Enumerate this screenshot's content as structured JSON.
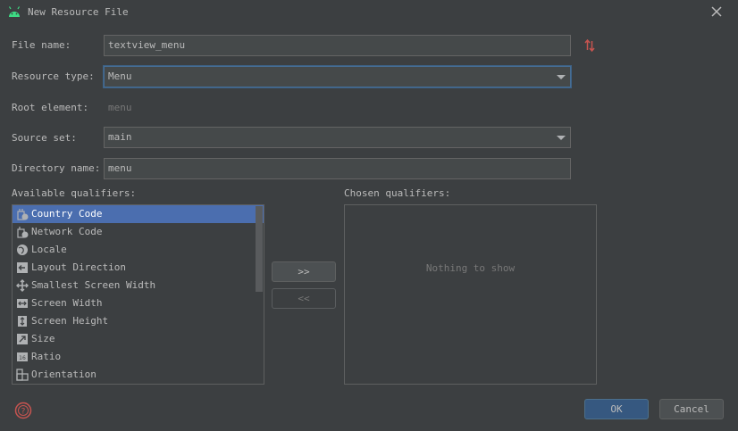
{
  "window": {
    "title": "New Resource File"
  },
  "form": {
    "file_name_label": "File name:",
    "file_name_value": "textview_menu",
    "resource_type_label": "Resource type:",
    "resource_type_value": "Menu",
    "root_element_label": "Root element:",
    "root_element_value": "menu",
    "source_set_label": "Source set:",
    "source_set_value": "main",
    "directory_name_label": "Directory name:",
    "directory_name_value": "menu"
  },
  "qualifiers": {
    "available_label": "Available qualifiers:",
    "chosen_label": "Chosen qualifiers:",
    "empty_text": "Nothing to show",
    "items": [
      {
        "label": "Country Code",
        "icon": "country-code-icon"
      },
      {
        "label": "Network Code",
        "icon": "network-code-icon"
      },
      {
        "label": "Locale",
        "icon": "globe-icon"
      },
      {
        "label": "Layout Direction",
        "icon": "layout-direction-icon"
      },
      {
        "label": "Smallest Screen Width",
        "icon": "smallest-screen-width-icon"
      },
      {
        "label": "Screen Width",
        "icon": "screen-width-icon"
      },
      {
        "label": "Screen Height",
        "icon": "screen-height-icon"
      },
      {
        "label": "Size",
        "icon": "size-icon"
      },
      {
        "label": "Ratio",
        "icon": "ratio-icon"
      },
      {
        "label": "Orientation",
        "icon": "orientation-icon"
      }
    ],
    "selected_index": 0,
    "add_button": ">>",
    "remove_button": "<<"
  },
  "buttons": {
    "ok": "OK",
    "cancel": "Cancel"
  },
  "colors": {
    "background": "#3c3f41",
    "selection": "#4b6eaf",
    "primary_button": "#365880",
    "android_green": "#3ddc84",
    "help_red": "#c75450"
  }
}
